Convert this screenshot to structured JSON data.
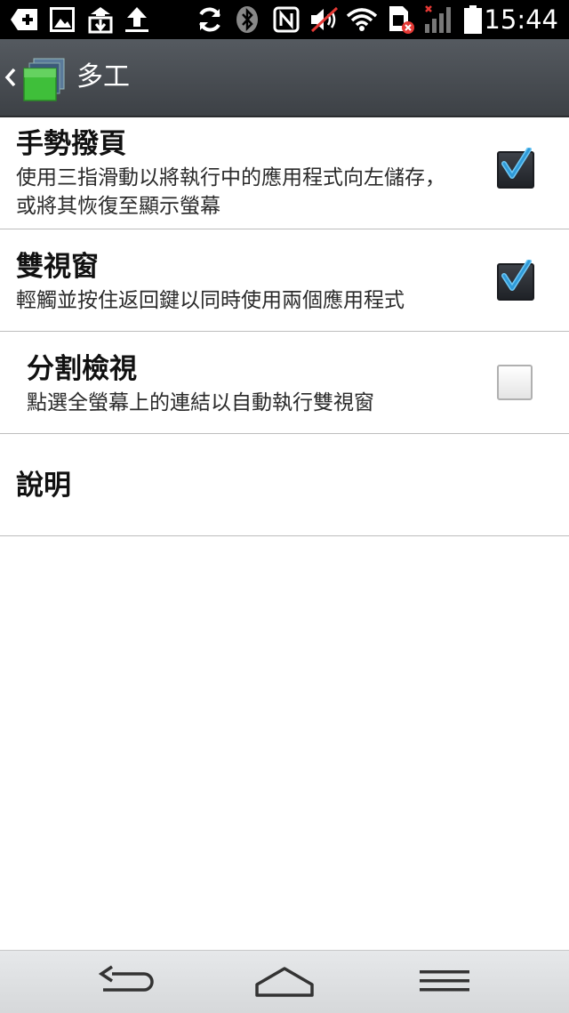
{
  "status_bar": {
    "time": "15:44",
    "icons": [
      "add-notification-icon",
      "image-icon",
      "download-icon",
      "upload-icon",
      "sync-icon",
      "bluetooth-icon",
      "nfc-icon",
      "mute-icon",
      "wifi-icon",
      "sim-error-icon",
      "signal-icon",
      "battery-icon"
    ]
  },
  "action_bar": {
    "title": "多工",
    "back_icon": "chevron-left-icon",
    "app_icon": "multitask-icon"
  },
  "settings": [
    {
      "title": "手勢撥頁",
      "description": "使用三指滑動以將執行中的應用程式向左儲存，或將其恢復至顯示螢幕",
      "checked": true
    },
    {
      "title": "雙視窗",
      "description": "輕觸並按住返回鍵以同時使用兩個應用程式",
      "checked": true
    },
    {
      "title": "分割檢視",
      "description": "點選全螢幕上的連結以自動執行雙視窗",
      "checked": false
    },
    {
      "title": "說明"
    }
  ],
  "nav_bar": {
    "back_icon": "back-arrow-icon",
    "home_icon": "home-icon",
    "menu_icon": "menu-icon"
  },
  "colors": {
    "action_bar": "#4a4e53",
    "check_accent": "#3aa8e6",
    "divider": "#bdbdbd"
  }
}
